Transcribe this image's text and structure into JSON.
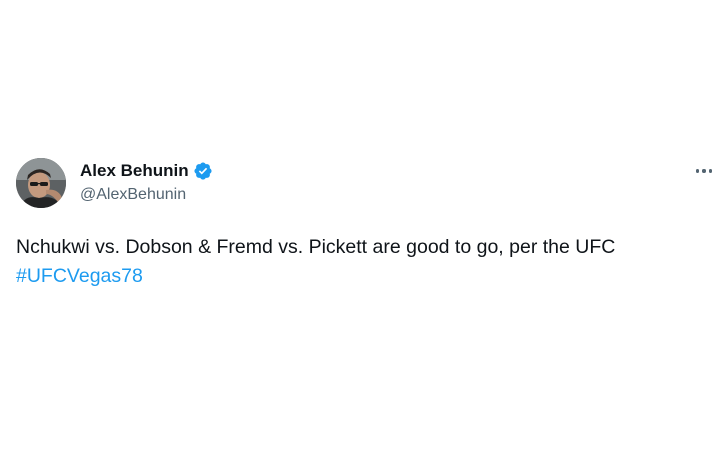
{
  "tweet": {
    "author": {
      "display_name": "Alex Behunin",
      "handle": "@AlexBehunin",
      "verified": true,
      "avatar_icon": "user-avatar"
    },
    "more_icon": "more-options-icon",
    "text_line": "Nchukwi vs. Dobson & Fremd vs. Pickett are good to go, per the UFC",
    "hashtag": "#UFCVegas78"
  },
  "colors": {
    "hashtag": "#1d9bf0",
    "verified_badge": "#1d9bf0",
    "secondary_text": "#536471",
    "primary_text": "#0f1419"
  }
}
